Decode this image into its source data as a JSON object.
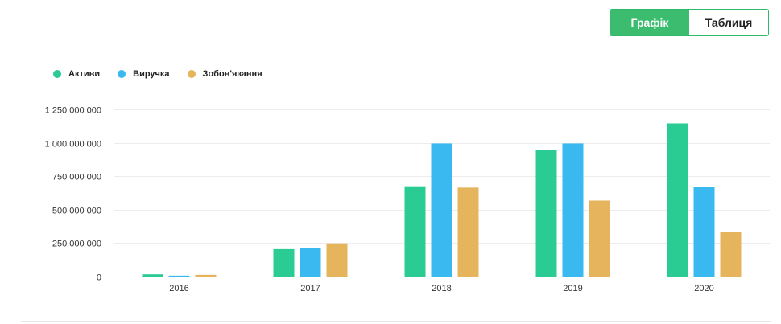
{
  "view_toggle": {
    "chart_label": "Графік",
    "table_label": "Таблиця"
  },
  "colors": {
    "accent": "#3cbc6f",
    "assets": "#2bcb94",
    "revenue": "#3ab8f0",
    "liabilities": "#e5b45c"
  },
  "chart_data": {
    "type": "bar",
    "categories": [
      "2016",
      "2017",
      "2018",
      "2019",
      "2020"
    ],
    "series": [
      {
        "name": "Активи",
        "color": "#2bcb94",
        "values": [
          17000000,
          205000000,
          675000000,
          945000000,
          1145000000
        ]
      },
      {
        "name": "Виручка",
        "color": "#3ab8f0",
        "values": [
          7000000,
          215000000,
          995000000,
          995000000,
          670000000
        ]
      },
      {
        "name": "Зобов'язання",
        "color": "#e5b45c",
        "values": [
          13000000,
          248000000,
          665000000,
          568000000,
          335000000
        ]
      }
    ],
    "y_ticks": [
      "0",
      "250 000 000",
      "500 000 000",
      "750 000 000",
      "1 000 000 000",
      "1 250 000 000"
    ],
    "ylim": [
      0,
      1250000000
    ],
    "grid": true,
    "legend": "top-left"
  }
}
